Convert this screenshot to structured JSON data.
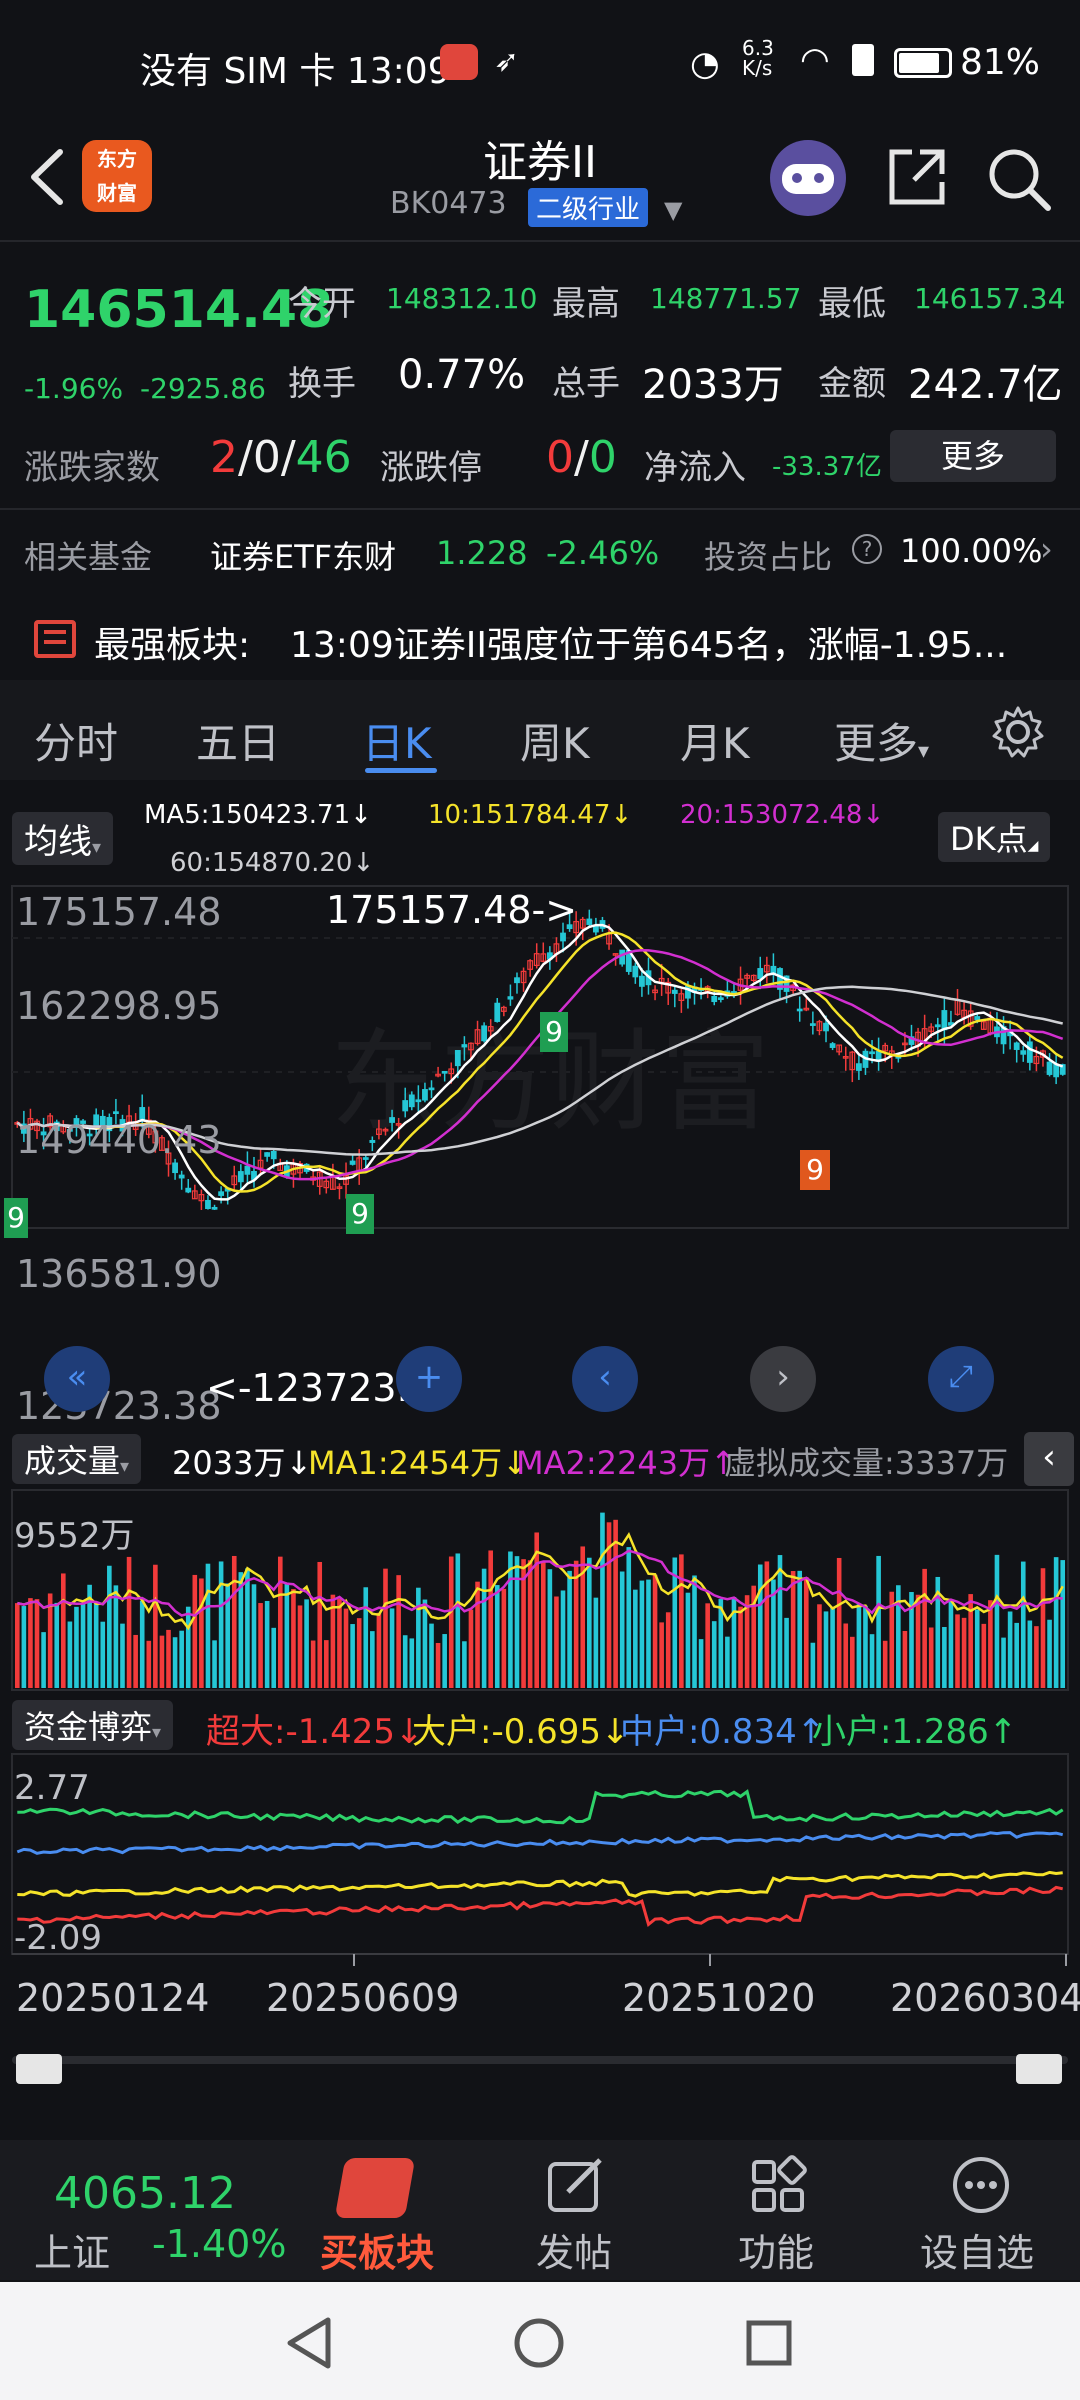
{
  "status": {
    "left": "没有 SIM 卡 13:09",
    "net_speed": "6.3 K/s",
    "battery": "81%"
  },
  "header": {
    "logo_text": "东方财富",
    "title": "证券II",
    "code": "BK0473",
    "badge": "二级行业"
  },
  "quote": {
    "price": "146514.48",
    "change_pct": "-1.96%",
    "change_val": "-2925.86",
    "open_label": "今开",
    "open": "148312.10",
    "high_label": "最高",
    "high": "148771.57",
    "low_label": "最低",
    "low": "146157.34",
    "turnover_label": "换手",
    "turnover": "0.77%",
    "volume_label": "总手",
    "volume": "2033万",
    "amount_label": "金额",
    "amount": "242.7亿",
    "updown_label": "涨跌家数",
    "up": "2",
    "flat": "0",
    "down": "46",
    "limit_label": "涨跌停",
    "limit_up": "0",
    "limit_down": "0",
    "netflow_label": "净流入",
    "netflow": "-33.37亿",
    "more_label": "更多"
  },
  "fund": {
    "label": "相关基金",
    "name": "证券ETF东财",
    "price": "1.228",
    "pct": "-2.46%",
    "ratio_label": "投资占比",
    "ratio": "100.00%"
  },
  "notice": {
    "label": "最强板块:",
    "text": "13:09证券II强度位于第645名，涨幅-1.95..."
  },
  "tabs": [
    "分时",
    "五日",
    "日K",
    "周K",
    "月K",
    "更多"
  ],
  "active_tab": "日K",
  "kline": {
    "indicator": "均线",
    "ma5": "MA5:150423.71↓",
    "ma10": "10:151784.47↓",
    "ma20": "20:153072.48↓",
    "ma60": "60:154870.20↓",
    "dk": "DK点",
    "y_labels": [
      "175157.48",
      "162298.95",
      "149440.43",
      "136581.90",
      "123723.38"
    ],
    "max_mark": "175157.48->",
    "min_mark": "<-123723.38",
    "badges": [
      "9",
      "9",
      "9",
      "9"
    ]
  },
  "volume": {
    "indicator": "成交量",
    "vol": "2033万↓",
    "ma1": "MA1:2454万↓",
    "ma2": "MA2:2243万↑",
    "virtual": "虚拟成交量:3337万",
    "y_label": "9552万"
  },
  "capital": {
    "indicator": "资金博弈",
    "super": "超大:-1.425↓",
    "big": "大户:-0.695↓",
    "mid": "中户:0.834↑",
    "small": "小户:1.286↑",
    "y_top": "2.77",
    "y_bottom": "-2.09"
  },
  "x_labels": [
    "20250124",
    "20250609",
    "20251020",
    "20260304"
  ],
  "bottom": {
    "index_value": "4065.12",
    "index_name": "上证",
    "index_pct": "-1.40%",
    "buy": "买板块",
    "post": "发帖",
    "func": "功能",
    "fav": "设自选"
  },
  "colors": {
    "up": "#f23b3b",
    "down": "#2fd36a",
    "accent": "#4a8df0",
    "ma5": "#ffffff",
    "ma10": "#f5e32a",
    "ma20": "#d22fd0",
    "ma60": "#cfd0d4"
  }
}
